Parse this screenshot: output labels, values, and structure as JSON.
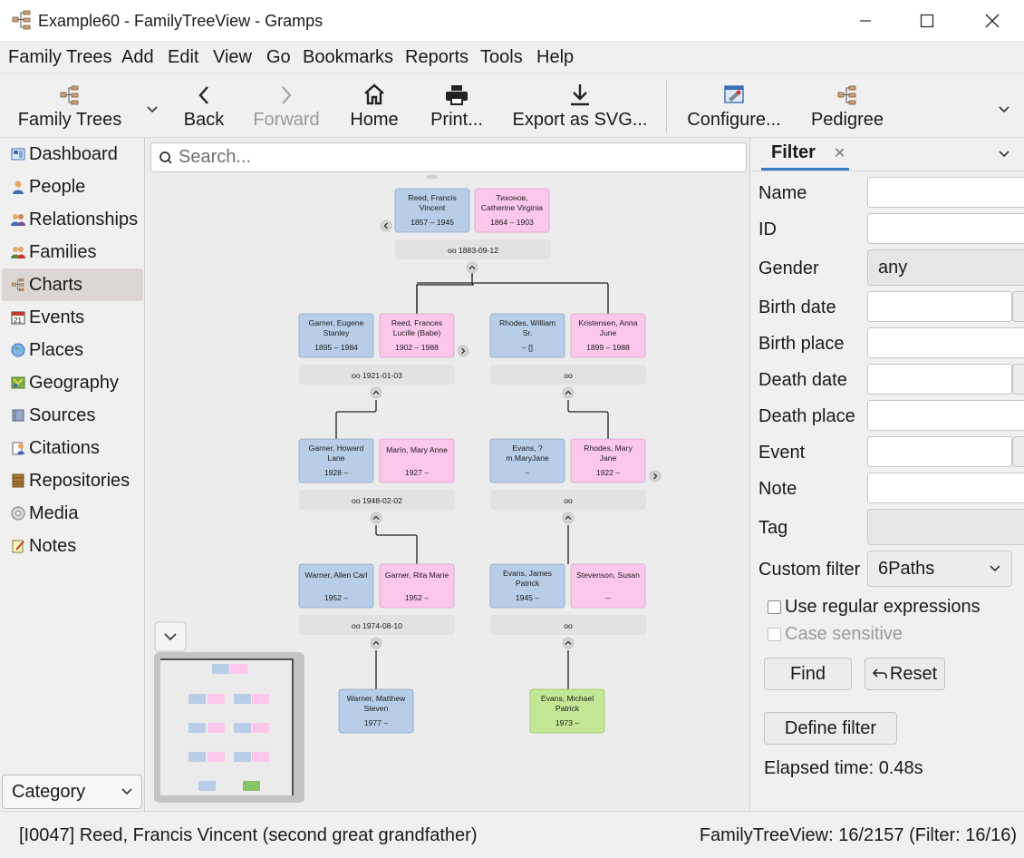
{
  "window": {
    "title": "Example60 - FamilyTreeView - Gramps"
  },
  "menu": [
    "Family Trees",
    "Add",
    "Edit",
    "View",
    "Go",
    "Bookmarks",
    "Reports",
    "Tools",
    "Help"
  ],
  "toolbar": {
    "family_trees": "Family Trees",
    "back": "Back",
    "forward": "Forward",
    "home": "Home",
    "print": "Print...",
    "export": "Export as SVG...",
    "configure": "Configure...",
    "pedigree": "Pedigree"
  },
  "sidebar": {
    "items": [
      {
        "label": "Dashboard",
        "icon": "dashboard-icon"
      },
      {
        "label": "People",
        "icon": "person-icon"
      },
      {
        "label": "Relationships",
        "icon": "relationships-icon"
      },
      {
        "label": "Families",
        "icon": "families-icon"
      },
      {
        "label": "Charts",
        "icon": "charts-icon"
      },
      {
        "label": "Events",
        "icon": "calendar-icon"
      },
      {
        "label": "Places",
        "icon": "globe-icon"
      },
      {
        "label": "Geography",
        "icon": "map-icon"
      },
      {
        "label": "Sources",
        "icon": "book-icon"
      },
      {
        "label": "Citations",
        "icon": "citation-icon"
      },
      {
        "label": "Repositories",
        "icon": "repository-icon"
      },
      {
        "label": "Media",
        "icon": "media-icon"
      },
      {
        "label": "Notes",
        "icon": "note-icon"
      }
    ],
    "active": "Charts",
    "category": "Category"
  },
  "search": {
    "placeholder": "Search..."
  },
  "colors": {
    "male": "#b7cde8",
    "female": "#fdc7ec",
    "active_person": "#c3e794",
    "family": "#e2e2e2"
  },
  "tree": {
    "people": [
      {
        "id": "p1",
        "name": "Reed, Francis\nVincent",
        "dates": "1857 – 1945",
        "sex": "male"
      },
      {
        "id": "p2",
        "name": "Тихонов,\nCatherine Virginia",
        "dates": "1864 – 1903",
        "sex": "female"
      },
      {
        "id": "p3",
        "name": "Garner, Eugene\nStanley",
        "dates": "1895 – 1984",
        "sex": "male"
      },
      {
        "id": "p4",
        "name": "Reed, Frances\nLucille (Babe)",
        "dates": "1902 – 1988",
        "sex": "female"
      },
      {
        "id": "p5",
        "name": "Rhodes, William\nSr.",
        "dates": "– []",
        "sex": "male"
      },
      {
        "id": "p6",
        "name": "Kristensen, Anna\nJune",
        "dates": "1899 – 1988",
        "sex": "female"
      },
      {
        "id": "p7",
        "name": "Garner, Howard\nLane",
        "dates": "1928 –",
        "sex": "male"
      },
      {
        "id": "p8",
        "name": "Marín, Mary Anne",
        "dates": "1927 –",
        "sex": "female"
      },
      {
        "id": "p9",
        "name": "Evans, ?\nm.MaryJane",
        "dates": "–",
        "sex": "male"
      },
      {
        "id": "p10",
        "name": "Rhodes, Mary\nJane",
        "dates": "1922 –",
        "sex": "female"
      },
      {
        "id": "p11",
        "name": "Warner, Allen Carl",
        "dates": "1952 –",
        "sex": "male"
      },
      {
        "id": "p12",
        "name": "Garner, Rita Marie",
        "dates": "1952 –",
        "sex": "female"
      },
      {
        "id": "p13",
        "name": "Evans, James\nPatrick",
        "dates": "1945 –",
        "sex": "male"
      },
      {
        "id": "p14",
        "name": "Stevenson, Susan",
        "dates": "–",
        "sex": "female"
      },
      {
        "id": "p15",
        "name": "Warner, Matthew\nSteven",
        "dates": "1977 –",
        "sex": "male"
      },
      {
        "id": "p16",
        "name": "Evans, Michael\nPatrick",
        "dates": "1973 –",
        "sex": "active"
      }
    ],
    "families": [
      {
        "id": "f1",
        "label": "oo 1883-09-12"
      },
      {
        "id": "f2",
        "label": "oo 1921-01-03"
      },
      {
        "id": "f3",
        "label": "oo"
      },
      {
        "id": "f4",
        "label": "oo 1948-02-02"
      },
      {
        "id": "f5",
        "label": "oo"
      },
      {
        "id": "f6",
        "label": "oo 1974-08-10"
      },
      {
        "id": "f7",
        "label": "oo"
      }
    ]
  },
  "filter": {
    "tab": "Filter",
    "fields": {
      "name": "Name",
      "id": "ID",
      "gender": "Gender",
      "birth_date": "Birth date",
      "birth_place": "Birth place",
      "death_date": "Death date",
      "death_place": "Death place",
      "event": "Event",
      "note": "Note",
      "tag": "Tag",
      "custom_filter": "Custom filter"
    },
    "gender_value": "any",
    "custom_filter_value": "6Paths",
    "use_regex": "Use regular expressions",
    "case_sensitive": "Case sensitive",
    "find": "Find",
    "reset": "Reset",
    "define_filter": "Define filter",
    "elapsed": "Elapsed time: 0.48s"
  },
  "status": {
    "left": "[I0047] Reed, Francis Vincent (second great grandfather)",
    "right": "FamilyTreeView: 16/2157 (Filter: 16/16)"
  }
}
